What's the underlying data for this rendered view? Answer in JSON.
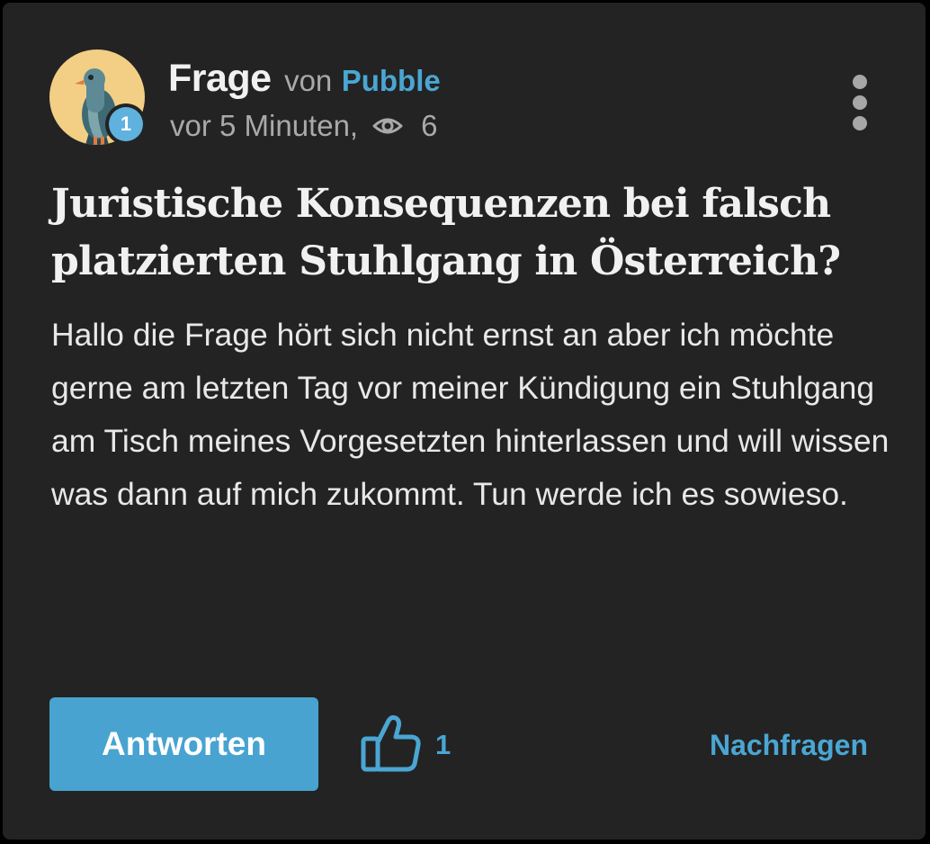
{
  "post": {
    "type_label": "Frage",
    "by_label": "von",
    "author": "Pubble",
    "author_level": "1",
    "time": "vor 5 Minuten,",
    "views": "6",
    "title": "Juristische Konsequenzen bei falsch platzierten Stuhlgang in Österreich?",
    "body": "Hallo die Frage hört sich nicht ernst an aber ich möchte gerne am letzten Tag vor meiner Kündigung ein Stuhlgang am Tisch meines Vorgesetzten hinterlassen und will wissen was dann auf mich zukommt. Tun werde ich es sowieso."
  },
  "actions": {
    "answer_label": "Antworten",
    "like_count": "1",
    "followup_label": "Nachfragen"
  },
  "icons": {
    "avatar": "pigeon-avatar",
    "views": "eye-icon",
    "menu": "more-vertical-icon",
    "like": "thumbs-up-icon"
  },
  "colors": {
    "background": "#232323",
    "accent": "#48a3d0",
    "text_primary": "#f1f1f1",
    "text_secondary": "#a9a9a9",
    "avatar_bg": "#f2cf85"
  }
}
